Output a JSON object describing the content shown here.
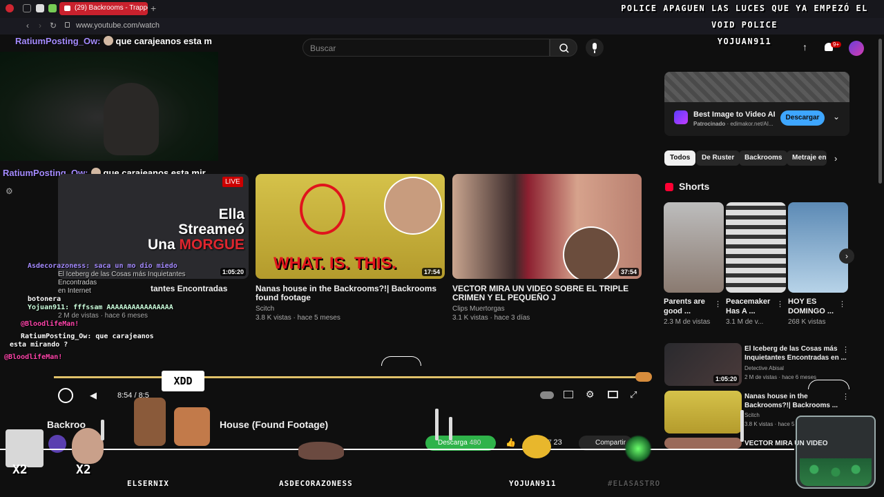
{
  "browser": {
    "tab_title": "(29) Backrooms - Trappec",
    "url": "www.youtube.com/watch"
  },
  "overlay_banner": {
    "line1": "POLICE APAGUEN LAS LUCES QUE YA EMPEZÓ EL",
    "line2": "VOID POLICE",
    "line3": "YOJUAN911"
  },
  "header": {
    "search_placeholder": "Buscar",
    "notification_count": "9+"
  },
  "stream_chat_top": {
    "user": "RatiumPosting_Ow:",
    "message": "que carajeanos esta m"
  },
  "stream_chat_mid": {
    "user": "RatiumPosting_Ow:",
    "message": "que carajeanos esta mir"
  },
  "videos": [
    {
      "title": "El Iceberg de las Cosas más Inquietantes Encontradas en Internet",
      "title_line1": "tantes Encontradas",
      "thumb_text_1": "Ella",
      "thumb_text_2": "Streameó",
      "thumb_text_3": "Una",
      "thumb_text_4": "MORGUE",
      "duration": "1:05:20",
      "live_badge": "LIVE",
      "meta": "2 M de vistas · hace 6 meses"
    },
    {
      "title": "Nanas house in the Backrooms?!| Backrooms found footage",
      "channel": "Scitch",
      "meta": "3.8 K vistas · hace 5 meses",
      "duration": "17:54",
      "thumb_caption": "WHAT. IS. THIS."
    },
    {
      "title": "VECTOR MIRA UN VIDEO SOBRE EL TRIPLE CRIMEN Y EL PEQUEÑO J",
      "channel": "Clips Muertorgas",
      "meta": "3.1 K vistas · hace 3 días",
      "duration": "37:54"
    }
  ],
  "chat_overlay": [
    "Asdecorazoness: saca un mo dio miedo",
    "El Iceberg de las Cosas más Inquietantes Encontradas",
    "en Internet",
    "botonera",
    "Yojuan911: fffssam AAAAAAAAAAAAAAAA",
    "@BloodlifeMan!",
    "RatiumPosting_Ow: que carajeanos",
    "esta mirando ?",
    "@BloodlifeMan!"
  ],
  "player": {
    "time": "8:54 / 8:5",
    "progress": 0.99,
    "title": "Backrooms - Trapped in Nana's House (Found Footage)",
    "title_visible_start": "Backroo",
    "title_visible_end": "House (Found Footage)",
    "download_label": "Descarga",
    "likes": "480",
    "dislikes": "23",
    "share_label": "Compartir"
  },
  "ad": {
    "title": "Best Image to Video AI",
    "sponsored": "Patrocinado",
    "domain": "· edimakor.net/AI...",
    "button": "Descargar"
  },
  "chips": [
    "Todos",
    "De Ruster",
    "Backrooms",
    "Metraje en"
  ],
  "shorts": {
    "heading": "Shorts",
    "items": [
      {
        "title_1": "Parents are",
        "title_2": "good ...",
        "meta": "2.3 M de vistas"
      },
      {
        "title_1": "Peacemaker",
        "title_2": "Has A ...",
        "meta": "3.1 M de v..."
      },
      {
        "title_1": "HOY ES",
        "title_2": "DOMINGO ...",
        "meta": "268 K vistas"
      }
    ]
  },
  "related": [
    {
      "title_1": "El Iceberg de las Cosas más",
      "title_2": "Inquietantes Encontradas en ...",
      "channel": "Detective Abisal",
      "meta": "2 M de vistas · hace 6 meses",
      "duration": "1:05:20"
    },
    {
      "title_1": "Nanas house in the",
      "title_2": "Backrooms?!| Backrooms ...",
      "channel": "Scitch",
      "meta": "3.8 K vistas · hace 5",
      "duration": ""
    },
    {
      "title_1": "VECTOR MIRA UN VIDEO",
      "title_2": "",
      "channel": "",
      "meta": "",
      "duration": ""
    }
  ],
  "stream_overlay": {
    "bubble": "XDD",
    "multipliers": [
      "X2",
      "X2"
    ],
    "names": [
      "ELSERNIX",
      "ASDECORAZONESS",
      "YOJUAN911",
      "#ELASASTRO"
    ]
  },
  "colors": {
    "youtube_red": "#cc0000",
    "ad_button": "#3ea6ff",
    "chat_user": "#a58bff",
    "progress": "#e0c16a"
  }
}
